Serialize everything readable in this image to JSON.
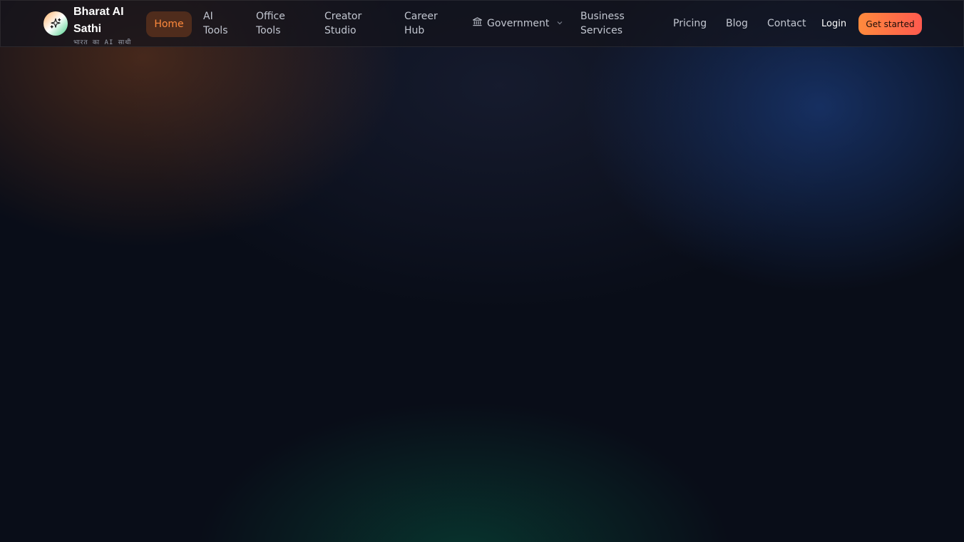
{
  "brand": {
    "name": "Bharat AI Sathi",
    "tagline": "भारत का AI साथी",
    "logo_icon": "sparkles-icon"
  },
  "nav": {
    "home": "Home",
    "ai_tools_line1": "AI",
    "ai_tools_line2": "Tools",
    "office_tools_line1": "Office",
    "office_tools_line2": "Tools",
    "creator_line1": "Creator",
    "creator_line2": "Studio",
    "career_line1": "Career",
    "career_line2": "Hub",
    "government": "Government",
    "government_icon": "bank-icon",
    "business_line1": "Business",
    "business_line2": "Services",
    "pricing": "Pricing",
    "blog": "Blog",
    "contact": "Contact"
  },
  "actions": {
    "login": "Login",
    "get_started": "Get started"
  },
  "colors": {
    "accent": "#ff8a3d",
    "cta_end": "#ff5a4e",
    "background": "#090d18"
  }
}
